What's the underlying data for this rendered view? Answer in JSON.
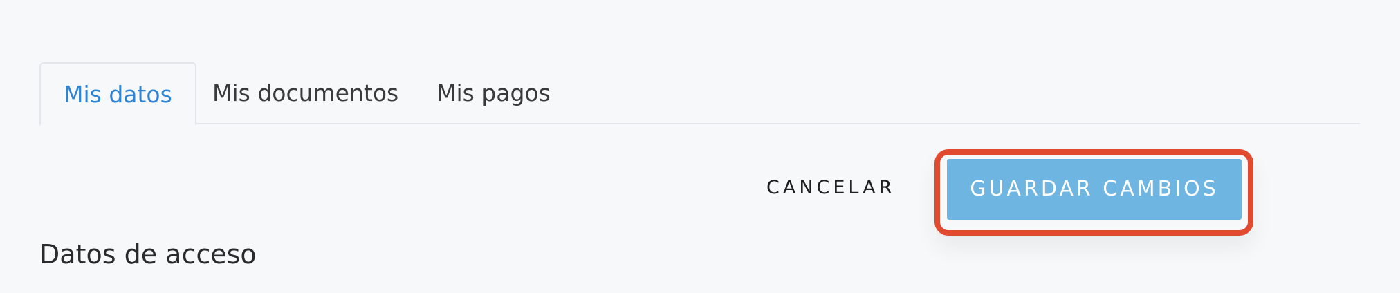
{
  "tabs": [
    {
      "label": "Mis datos",
      "active": true
    },
    {
      "label": "Mis documentos",
      "active": false
    },
    {
      "label": "Mis pagos",
      "active": false
    }
  ],
  "actions": {
    "cancel_label": "CANCELAR",
    "save_label": "GUARDAR CAMBIOS"
  },
  "section": {
    "title": "Datos de acceso"
  },
  "colors": {
    "active_tab": "#2f83d4",
    "primary_button": "#6fb5e1",
    "highlight_outline": "#e24a30",
    "background": "#f7f8fa"
  }
}
